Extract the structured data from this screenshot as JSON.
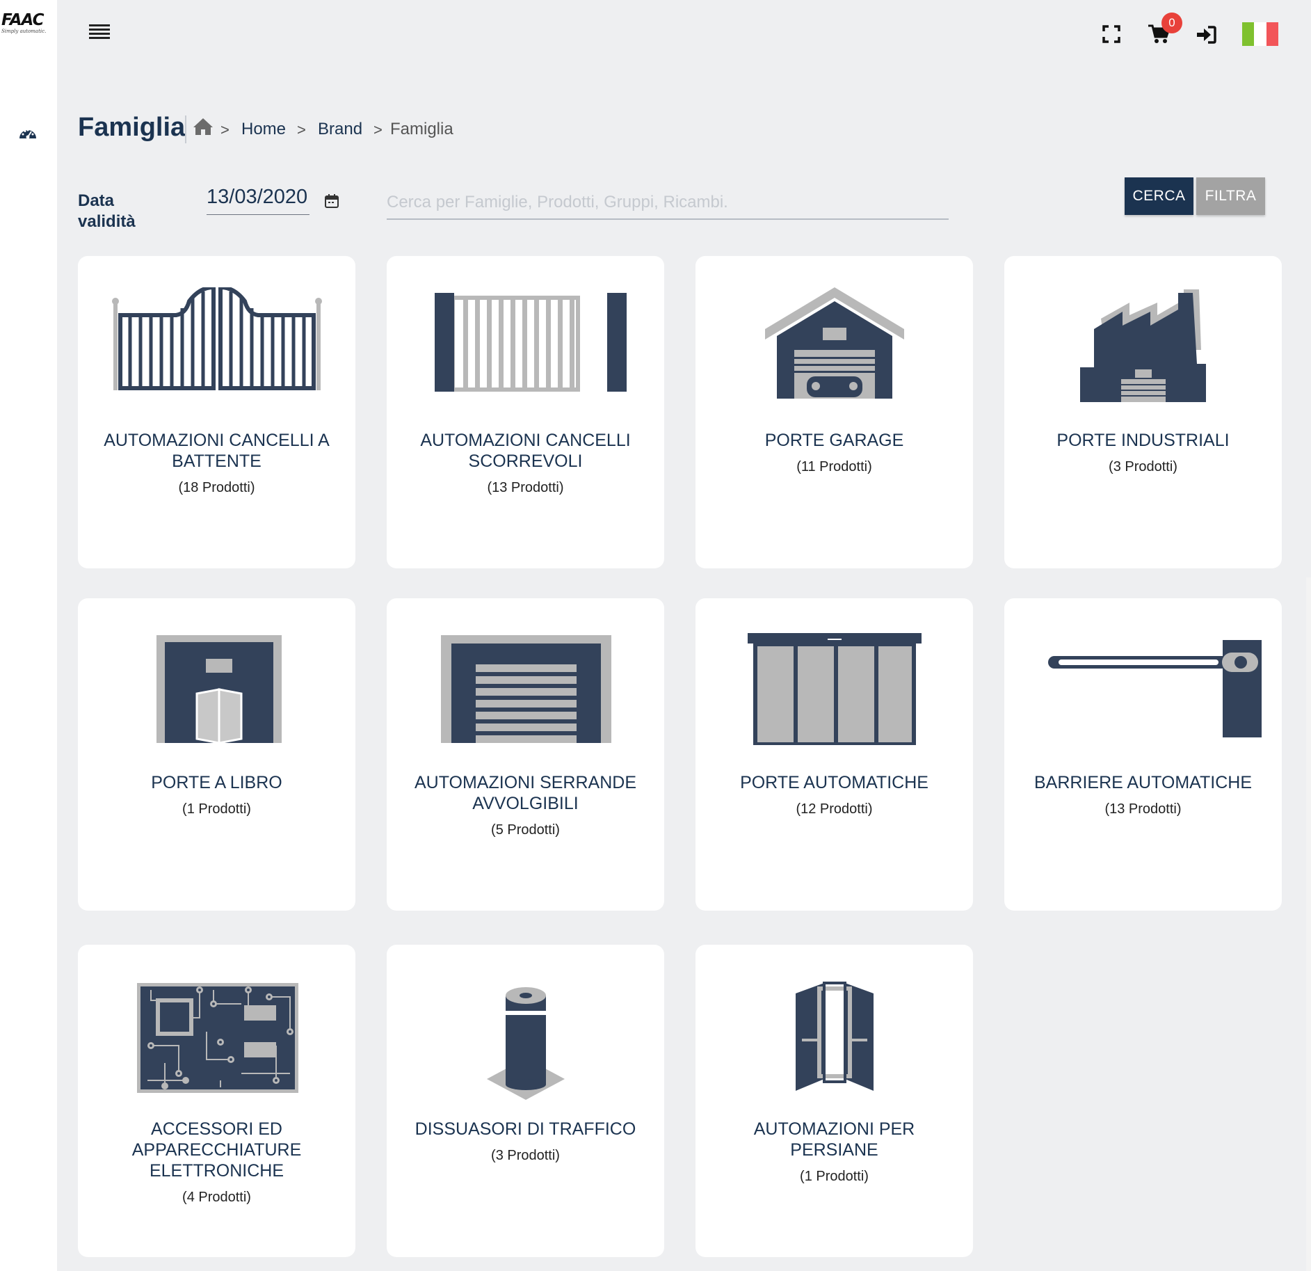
{
  "brand": {
    "logo_text": "FAAC",
    "tagline": "Simply automatic."
  },
  "header": {
    "cart_count": "0",
    "flag_colors": [
      "#7fc12f",
      "#ffffff",
      "#f25559"
    ]
  },
  "page": {
    "title": "Famiglia"
  },
  "breadcrumb": {
    "items": [
      "Home",
      "Brand",
      "Famiglia"
    ],
    "separator": ">"
  },
  "filters": {
    "date_label": "Data validità",
    "date_value": "13/03/2020",
    "search_placeholder": "Cerca per Famiglie, Prodotti, Gruppi, Ricambi.",
    "search_button": "CERCA",
    "filter_button": "FILTRA"
  },
  "families": [
    {
      "name": "AUTOMAZIONI CANCELLI A BATTENTE",
      "count": "(18 Prodotti)",
      "icon": "swing-gate-icon"
    },
    {
      "name": "AUTOMAZIONI CANCELLI SCORREVOLI",
      "count": "(13 Prodotti)",
      "icon": "sliding-gate-icon"
    },
    {
      "name": "PORTE GARAGE",
      "count": "(11 Prodotti)",
      "icon": "garage-door-icon"
    },
    {
      "name": "PORTE INDUSTRIALI",
      "count": "(3 Prodotti)",
      "icon": "factory-icon"
    },
    {
      "name": "PORTE A LIBRO",
      "count": "(1 Prodotti)",
      "icon": "folding-door-icon"
    },
    {
      "name": "AUTOMAZIONI SERRANDE AVVOLGIBILI",
      "count": "(5 Prodotti)",
      "icon": "rolling-shutter-icon"
    },
    {
      "name": "PORTE AUTOMATICHE",
      "count": "(12 Prodotti)",
      "icon": "automatic-door-icon"
    },
    {
      "name": "BARRIERE AUTOMATICHE",
      "count": "(13 Prodotti)",
      "icon": "barrier-icon"
    },
    {
      "name": "ACCESSORI ED APPARECCHIATURE ELETTRONICHE",
      "count": "(4 Prodotti)",
      "icon": "circuit-board-icon"
    },
    {
      "name": "DISSUASORI DI TRAFFICO",
      "count": "(3 Prodotti)",
      "icon": "bollard-icon"
    },
    {
      "name": "AUTOMAZIONI PER PERSIANE",
      "count": "(1 Prodotti)",
      "icon": "shutters-icon"
    }
  ],
  "colors": {
    "navy": "#1b3350",
    "icon_dark": "#33425a",
    "icon_grey": "#b8b8b8",
    "background": "#eeeff1",
    "badge": "#e8413a"
  }
}
